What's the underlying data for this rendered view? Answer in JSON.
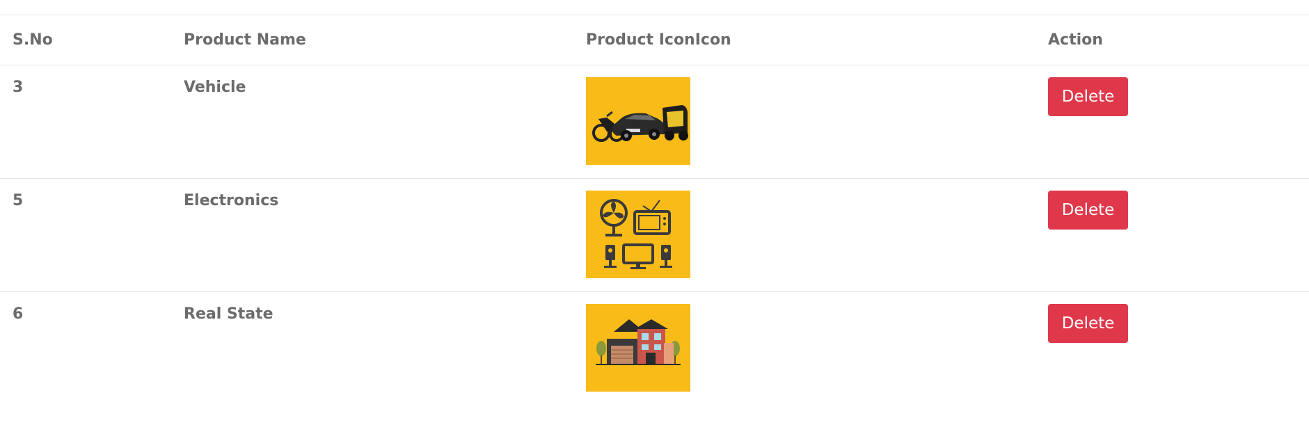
{
  "table": {
    "headers": {
      "sno": "S.No",
      "name": "Product Name",
      "icon": "Product IconIcon",
      "action": "Action"
    },
    "rows": [
      {
        "sno": "3",
        "name": "Vehicle",
        "icon": "vehicle-icon",
        "action_label": "Delete"
      },
      {
        "sno": "5",
        "name": "Electronics",
        "icon": "electronics-icon",
        "action_label": "Delete"
      },
      {
        "sno": "6",
        "name": "Real State",
        "icon": "house-icon",
        "action_label": "Delete"
      }
    ]
  },
  "colors": {
    "thumb_bg": "#f8bb18",
    "delete_bg": "#e0384b",
    "text": "#6b6b6b"
  }
}
